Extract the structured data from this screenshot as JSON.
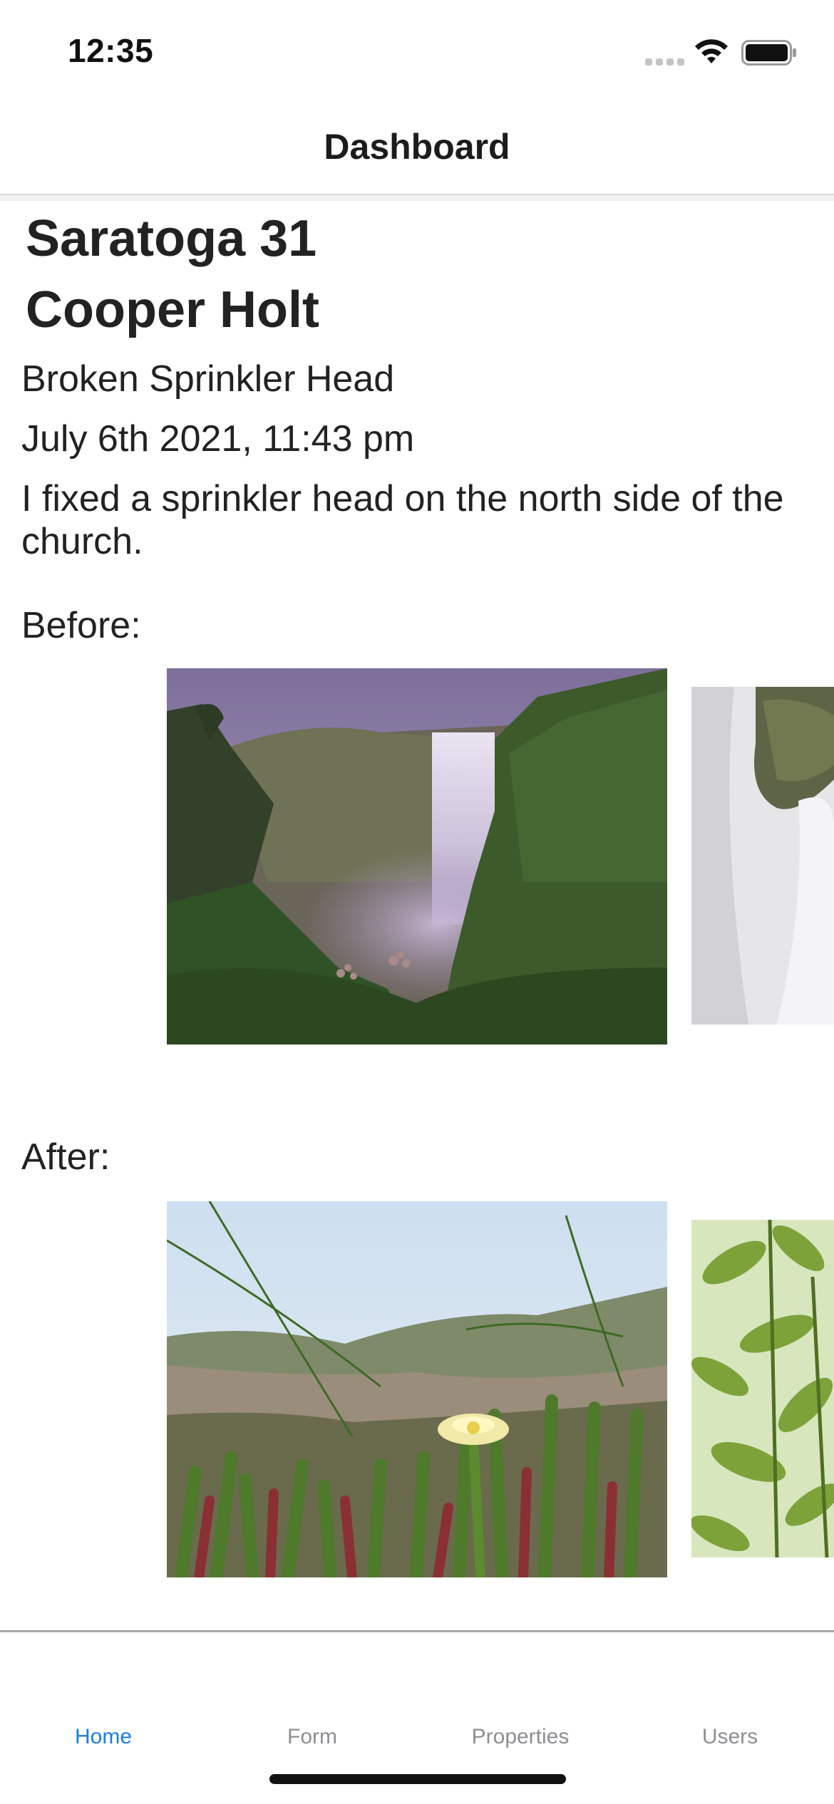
{
  "status_bar": {
    "time": "12:35",
    "icons": [
      "cellular-signal-icon",
      "wifi-icon",
      "battery-icon"
    ]
  },
  "header": {
    "title": "Dashboard"
  },
  "entry": {
    "property": "Saratoga 31",
    "user": "Cooper Holt",
    "title": "Broken Sprinkler Head",
    "date": "July 6th 2021, 11:43 pm",
    "description": "I fixed a sprinkler head on the north side of the church.",
    "before_label": "Before:",
    "after_label": "After:"
  },
  "tab_bar": {
    "active": "Home",
    "active_color": "#1a7ee6",
    "inactive_color": "#8e8e93",
    "tabs": [
      {
        "label": "Home"
      },
      {
        "label": "Form"
      },
      {
        "label": "Properties"
      },
      {
        "label": "Users"
      }
    ]
  }
}
